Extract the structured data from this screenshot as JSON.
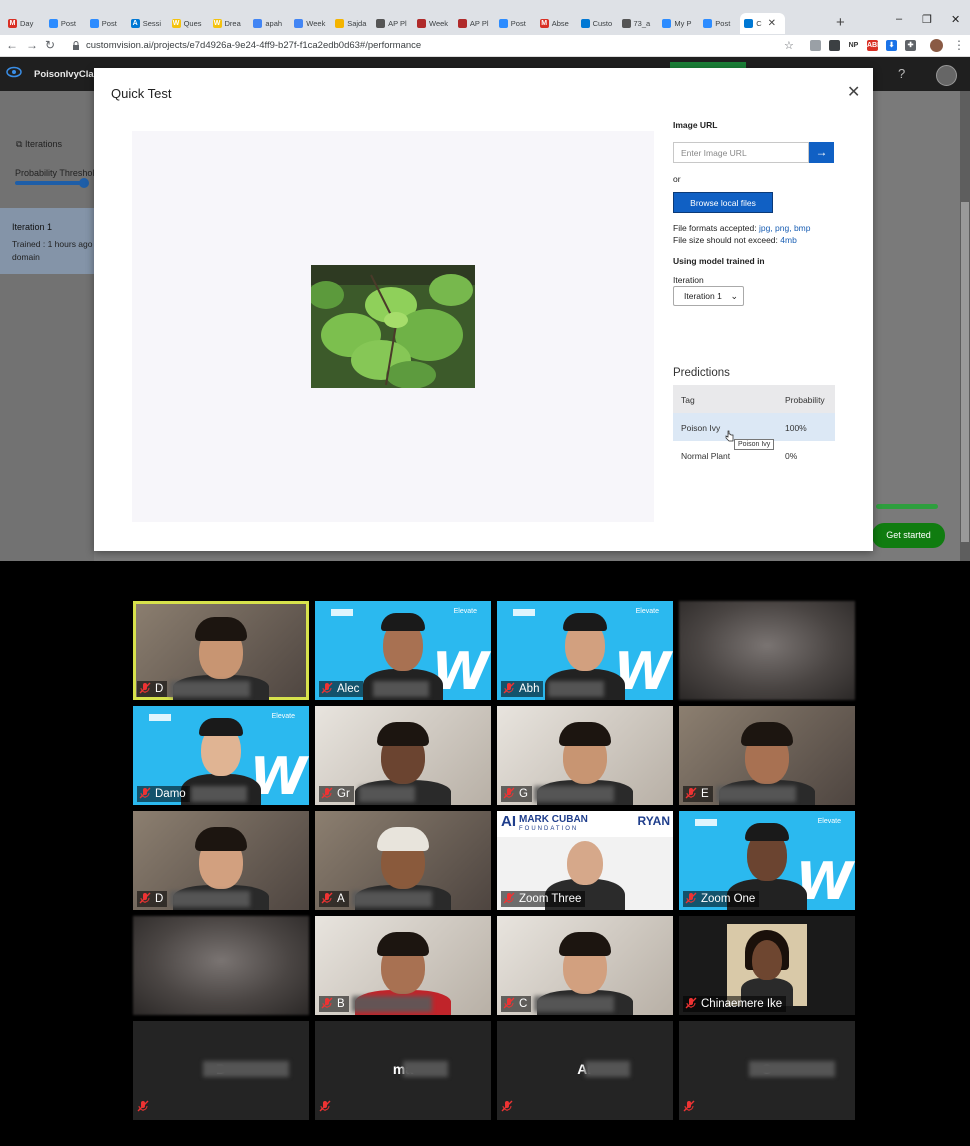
{
  "browser": {
    "tabs": [
      {
        "label": "Day",
        "fav": "M",
        "color": "#d93025"
      },
      {
        "label": "Post",
        "fav": "",
        "color": "#2d8cff"
      },
      {
        "label": "Post",
        "fav": "",
        "color": "#2d8cff"
      },
      {
        "label": "Sessi",
        "fav": "A",
        "color": "#0078d4"
      },
      {
        "label": "Ques",
        "fav": "W",
        "color": "#f4c20d"
      },
      {
        "label": "Drea",
        "fav": "W",
        "color": "#f4c20d"
      },
      {
        "label": "apah",
        "fav": "",
        "color": "#4285f4"
      },
      {
        "label": "Week",
        "fav": "",
        "color": "#4285f4"
      },
      {
        "label": "Sajda",
        "fav": "",
        "color": "#f4b400"
      },
      {
        "label": "AP Pl",
        "fav": "",
        "color": "#555555"
      },
      {
        "label": "Week",
        "fav": "",
        "color": "#b02a2a"
      },
      {
        "label": "AP Pl",
        "fav": "",
        "color": "#b02a2a"
      },
      {
        "label": "Post",
        "fav": "",
        "color": "#2d8cff"
      },
      {
        "label": "Abse",
        "fav": "M",
        "color": "#d93025"
      },
      {
        "label": "Custo",
        "fav": "",
        "color": "#0078d4"
      },
      {
        "label": "73_a",
        "fav": "",
        "color": "#555555"
      },
      {
        "label": "My P",
        "fav": "",
        "color": "#2d8cff"
      },
      {
        "label": "Post",
        "fav": "",
        "color": "#2d8cff"
      },
      {
        "label": "C",
        "fav": "",
        "color": "#0078d4",
        "active": true
      }
    ],
    "new_tab": "+",
    "window_controls": {
      "minimize": "–",
      "maximize": "❐",
      "close": "✕"
    },
    "url": "customvision.ai/projects/e7d4926a-9e24-4ff9-b27f-f1ca2edb0d63#/performance",
    "extensions": [
      {
        "name": "ext-gray",
        "label": "",
        "color": "#9aa0a6"
      },
      {
        "name": "ext-dark",
        "label": "",
        "color": "#3c4043"
      },
      {
        "name": "ext-np",
        "label": "NP",
        "color": "#ffffff"
      },
      {
        "name": "ext-adblock",
        "label": "ABP",
        "color": "#d93025"
      },
      {
        "name": "ext-download",
        "label": "⬇",
        "color": "#1a73e8"
      },
      {
        "name": "ext-puzzle",
        "label": "✚",
        "color": "#5f6368"
      }
    ]
  },
  "app": {
    "project_name": "PoisonIvyClass",
    "help": "?",
    "sidebar": {
      "iterations_link": "Iterations",
      "probability_label": "Probability Threshol",
      "iteration_title": "Iteration 1",
      "iteration_trained": "Trained : 1 hours ago",
      "iteration_domain": "domain"
    },
    "get_started": "Get started"
  },
  "modal": {
    "title": "Quick Test",
    "close": "✕",
    "image_url_label": "Image URL",
    "image_url_placeholder": "Enter Image URL",
    "go_arrow": "→",
    "or": "or",
    "browse_button": "Browse local files",
    "formats_prefix": "File formats accepted: ",
    "formats": "jpg, png, bmp",
    "size_prefix": "File size should not exceed: ",
    "size": "4mb",
    "using_model": "Using model trained in",
    "iteration_label": "Iteration",
    "iteration_value": "Iteration 1",
    "predictions_title": "Predictions",
    "table": {
      "headers": [
        "Tag",
        "Probability"
      ],
      "rows": [
        {
          "tag": "Poison Ivy",
          "prob": "100%"
        },
        {
          "tag": "Normal Plant",
          "prob": "0%"
        }
      ]
    },
    "tooltip": "Poison Ivy"
  },
  "zoom": {
    "participants": [
      {
        "name": "D",
        "style": "room"
      },
      {
        "name": "Alec",
        "style": "blue"
      },
      {
        "name": "Abh",
        "style": "blue"
      },
      {
        "name": "",
        "style": "blur"
      },
      {
        "name": "Damo",
        "style": "blue"
      },
      {
        "name": "Gr",
        "style": "room-light"
      },
      {
        "name": "G",
        "style": "room-light"
      },
      {
        "name": "E",
        "style": "room"
      },
      {
        "name": "D",
        "style": "room"
      },
      {
        "name": "A",
        "style": "room"
      },
      {
        "name": "Zoom Three",
        "style": "mc"
      },
      {
        "name": "Zoom One",
        "style": "blue"
      },
      {
        "name": "",
        "style": "blur"
      },
      {
        "name": "B",
        "style": "room-light"
      },
      {
        "name": "C",
        "style": "room-light"
      },
      {
        "name": "Chinaemere Ike",
        "style": "photo"
      },
      {
        "name": "D",
        "style": "noVideo"
      },
      {
        "name": "ma",
        "style": "noVideo"
      },
      {
        "name": "Ar",
        "style": "noVideo"
      },
      {
        "name": "O",
        "style": "noVideo"
      }
    ],
    "mc_banner": {
      "mark": "MARK CUBAN",
      "foundation": "FOUNDATION",
      "ryan": "RYAN",
      "ai": "AI"
    },
    "elevate": "Elevate"
  }
}
